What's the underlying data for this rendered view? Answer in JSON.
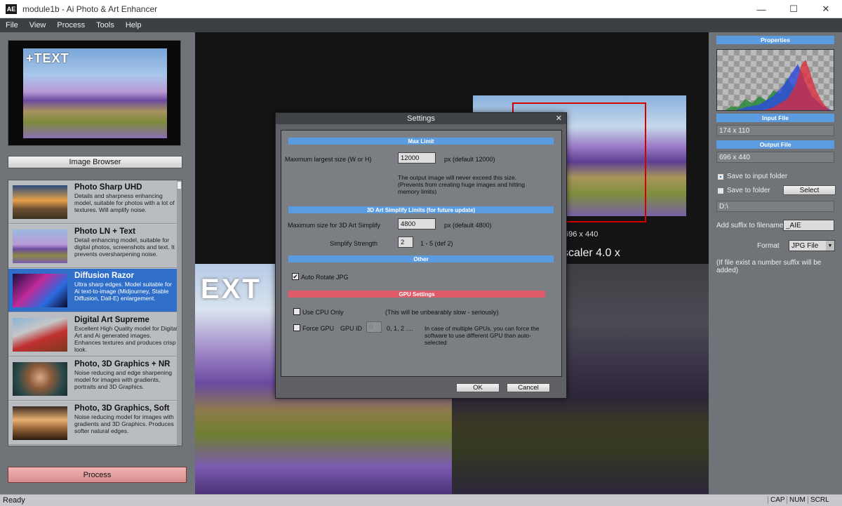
{
  "window": {
    "title": "module1b - Ai Photo & Art Enhancer",
    "app_icon": "AE",
    "minimize": "—",
    "maximize": "☐",
    "close": "✕"
  },
  "menu": [
    "File",
    "View",
    "Process",
    "Tools",
    "Help"
  ],
  "left": {
    "preview_text": "+TEXT",
    "image_browser_label": "Image Browser",
    "models": [
      {
        "name": "Photo Sharp UHD",
        "desc": "Details and sharpness enhancing model, suitable for photos with a lot of textures. Will amplify noise."
      },
      {
        "name": "Photo LN + Text",
        "desc": "Detail enhancing model, suitable for digital photos, screenshots and text. It prevents oversharpening noise."
      },
      {
        "name": "Diffusion Razor",
        "desc": "Ultra sharp edges. Model suitable for Ai text-to-image (Midjourney, Stable Diffusion, Dall-E) enlargement."
      },
      {
        "name": "Digital Art Supreme",
        "desc": "Excellent High Quality model for Digital Art and Ai generated images. Enhances textures and produces crisp look."
      },
      {
        "name": "Photo, 3D Graphics + NR",
        "desc": "Noise reducing and edge sharpening model for images with gradients, portraits and 3D Graphics."
      },
      {
        "name": "Photo, 3D Graphics, Soft",
        "desc": "Noise reducing model for images with gradients and 3D Graphics. Produces softer natural edges."
      }
    ],
    "selected_model": "Diffusion Razor",
    "process_label": "Process"
  },
  "center": {
    "size_label": "696 x 440",
    "scaler_label": "scaler 4.0 x",
    "big_text": "EXT"
  },
  "right": {
    "properties_header": "Properties",
    "input_header": "Input File",
    "input_size": "174 x 110",
    "output_header": "Output File",
    "output_size": "696 x 440",
    "save_input_label": "Save to input folder",
    "save_folder_label": "Save to folder",
    "select_label": "Select",
    "folder_path": "D:\\",
    "suffix_label": "Add suffix to filename",
    "suffix_value": "_AIE",
    "format_label": "Format",
    "format_value": "JPG File",
    "note": "(If file exist a number suffix will be added)",
    "save_to_input_checked": true
  },
  "dialog": {
    "title": "Settings",
    "close": "✕",
    "max_limit_header": "Max Limit",
    "max_size_label": "Maximum largest size (W or H)",
    "max_size_value": "12000",
    "max_size_default": "px (default 12000)",
    "max_note": "The output image will never exceed this size. (Prevents from creating huge images and hitting memory limits)",
    "simplify_header": "3D Art Simplify Limits (for future update)",
    "simplify_size_label": "Maximum size for 3D Art Simplify",
    "simplify_size_value": "4800",
    "simplify_size_default": "px (default 4800)",
    "strength_label": "Simplify Strength",
    "strength_value": "2",
    "strength_range": "1 - 5 (def 2)",
    "other_header": "Other",
    "auto_rotate_label": "Auto Rotate JPG",
    "auto_rotate_checked": true,
    "gpu_header": "GPU Settings",
    "cpu_only_label": "Use CPU Only",
    "cpu_only_note": "(This will be unbearably slow - seriously)",
    "force_gpu_label": "Force GPU",
    "gpu_id_label": "GPU ID",
    "gpu_id_value": "0",
    "gpu_id_options": "0, 1, 2 ....",
    "gpu_note": "In case of multiple GPUs, you can force the software to use different GPU than auto-selected",
    "ok_label": "OK",
    "cancel_label": "Cancel"
  },
  "status": {
    "text": "Ready",
    "cap": "CAP",
    "num": "NUM",
    "scrl": "SCRL"
  }
}
